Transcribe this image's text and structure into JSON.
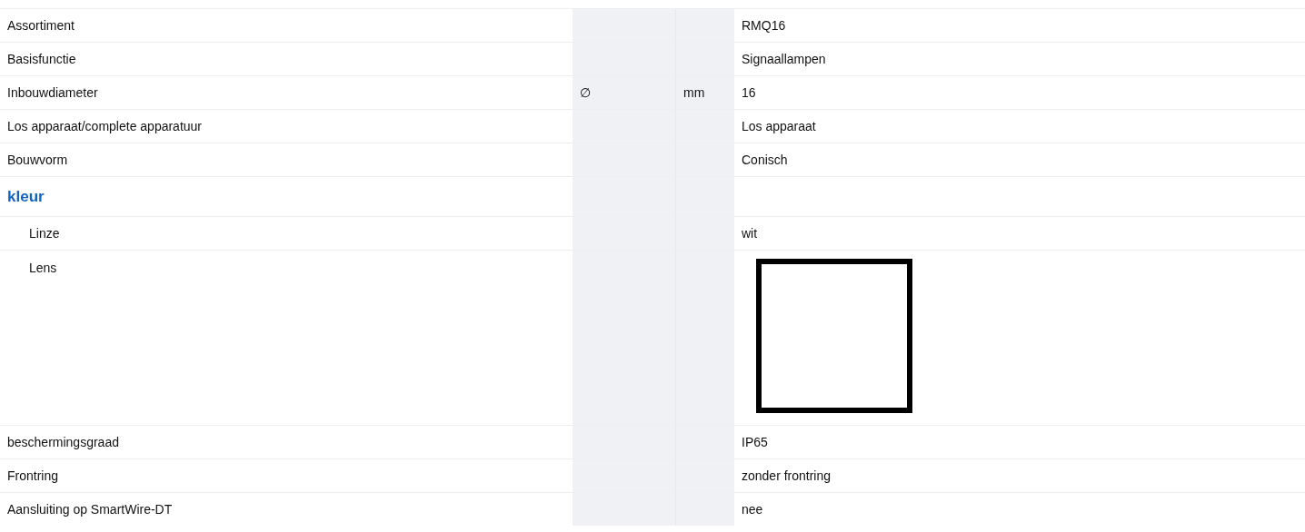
{
  "rows": [
    {
      "kind": "row",
      "label": "Assortiment",
      "value": "RMQ16"
    },
    {
      "kind": "row",
      "label": "Basisfunctie",
      "value": "Signaallampen"
    },
    {
      "kind": "row",
      "label": "Inbouwdiameter",
      "symbol": "∅",
      "unit": "mm",
      "value": "16"
    },
    {
      "kind": "row",
      "label": "Los apparaat/complete apparatuur",
      "value": "Los apparaat"
    },
    {
      "kind": "row",
      "label": "Bouwvorm",
      "value": "Conisch"
    },
    {
      "kind": "section",
      "label": "kleur",
      "children": [
        {
          "kind": "row",
          "label": "Linze",
          "value": "wit"
        },
        {
          "kind": "swatch",
          "label": "Lens",
          "color": "#ffffff"
        }
      ]
    },
    {
      "kind": "row",
      "label": "beschermingsgraad",
      "value": "IP65"
    },
    {
      "kind": "row",
      "label": "Frontring",
      "value": "zonder frontring"
    },
    {
      "kind": "row",
      "label": "Aansluiting op SmartWire-DT",
      "value": "nee"
    }
  ]
}
